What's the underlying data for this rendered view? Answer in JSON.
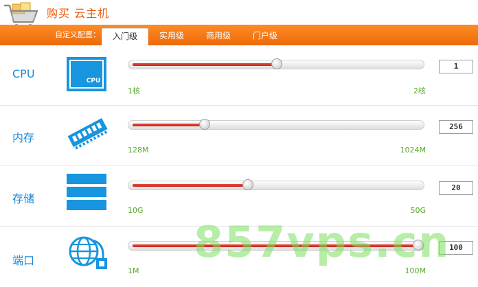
{
  "header": {
    "title": "购买 云主机"
  },
  "tabbar": {
    "prefix": "自定义配置：",
    "tabs": [
      {
        "label": "入门级",
        "active": true
      },
      {
        "label": "实用级",
        "active": false
      },
      {
        "label": "商用级",
        "active": false
      },
      {
        "label": "门户级",
        "active": false
      }
    ]
  },
  "rows": [
    {
      "label": "CPU",
      "icon": "cpu-icon",
      "icon_text": "CPU",
      "value": "1",
      "range_min": "1核",
      "range_max": "2核",
      "level": 0.5
    },
    {
      "label": "内存",
      "icon": "memory-icon",
      "value": "256",
      "range_min": "128M",
      "range_max": "1024M",
      "level": 0.25
    },
    {
      "label": "存储",
      "icon": "storage-icon",
      "value": "20",
      "range_min": "10G",
      "range_max": "50G",
      "level": 0.4
    },
    {
      "label": "端口",
      "icon": "network-icon",
      "value": "100",
      "range_min": "1M",
      "range_max": "100M",
      "level": 1.0
    }
  ],
  "watermark": {
    "text": "857vps.cn"
  },
  "colors": {
    "accent": "#f57a17",
    "label_blue": "#1d8ad9",
    "range_green": "#55a82a",
    "slider_red": "#d4392a"
  }
}
